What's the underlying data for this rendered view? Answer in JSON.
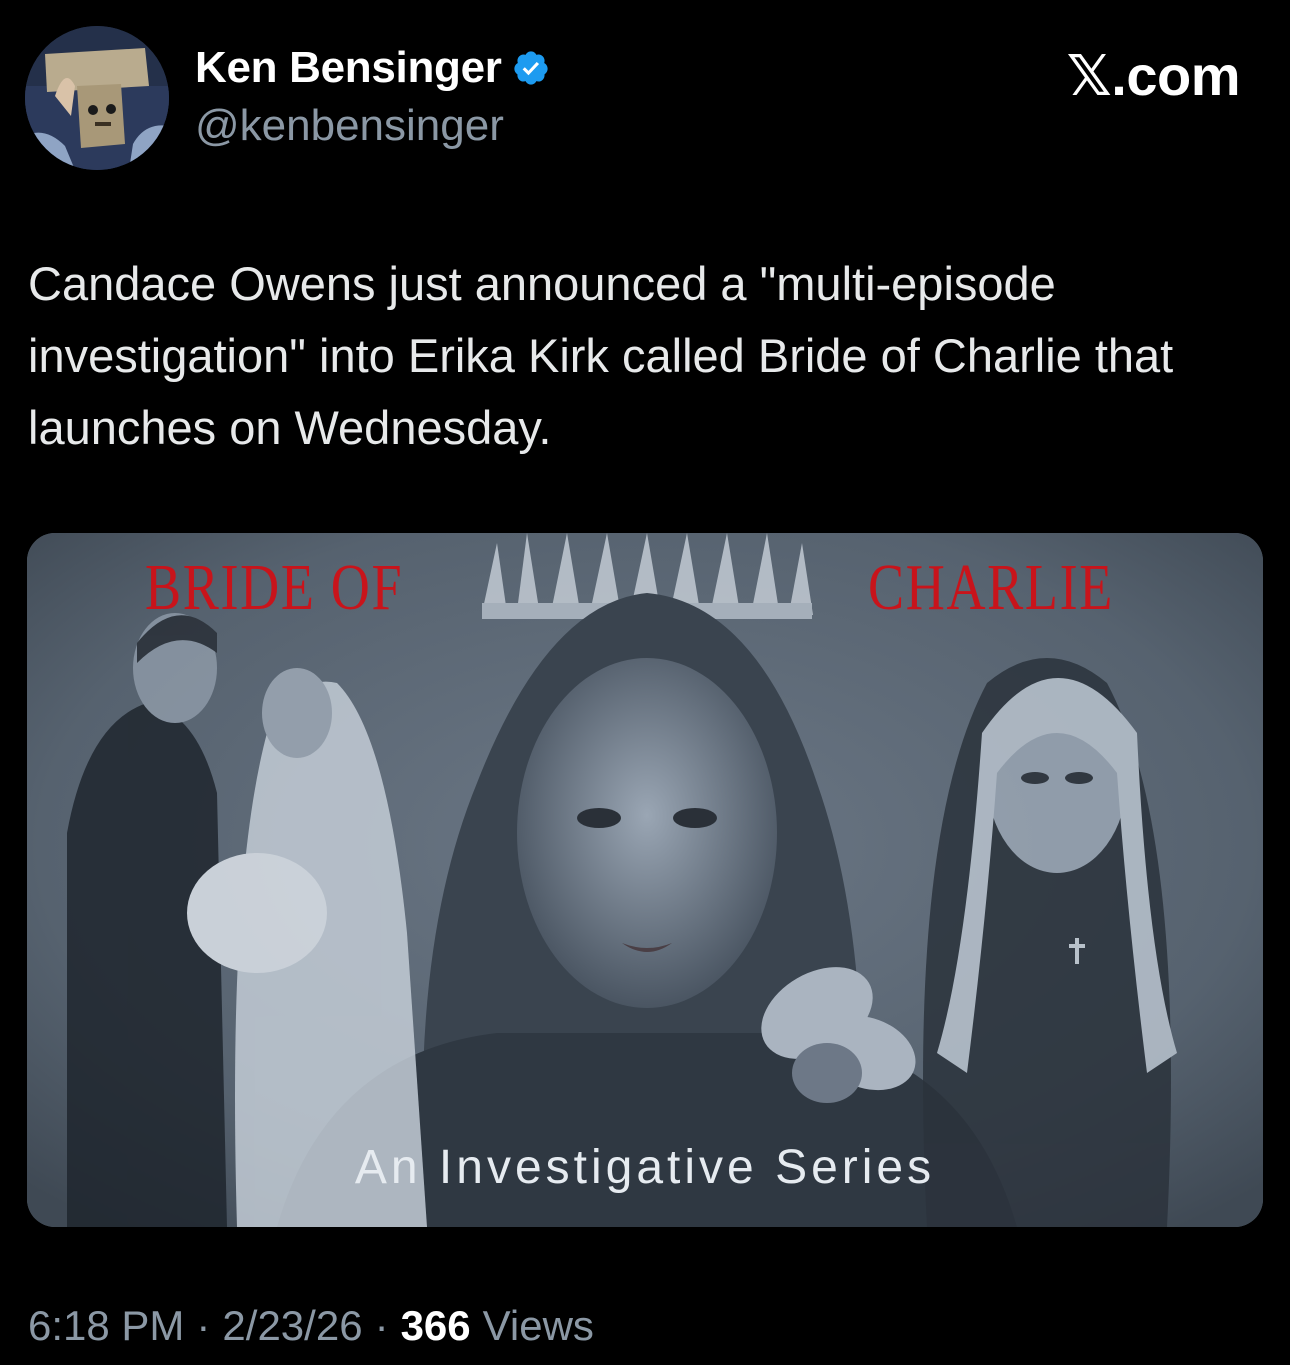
{
  "author": {
    "display_name": "Ken Bensinger",
    "handle": "@kenbensinger",
    "verified": true,
    "avatar_icon": "profile-photo"
  },
  "brand": {
    "label": ".com",
    "icon": "x-logo-icon"
  },
  "tweet": {
    "text": "Candace Owens just announced a \"multi-episode investigation\" into Erika Kirk called Bride of Charlie that launches on Wednesday."
  },
  "media": {
    "title_left": "BRIDE OF",
    "title_right": "CHARLIE",
    "subtitle": "An Investigative Series",
    "title_color": "#c8141b"
  },
  "meta": {
    "time": "6:18 PM",
    "separator": "·",
    "date": "2/23/26",
    "views_count": "366",
    "views_label": "Views"
  },
  "colors": {
    "background": "#000000",
    "text": "#e7e9ea",
    "secondary": "#8b98a5",
    "verified": "#1d9bf0"
  }
}
